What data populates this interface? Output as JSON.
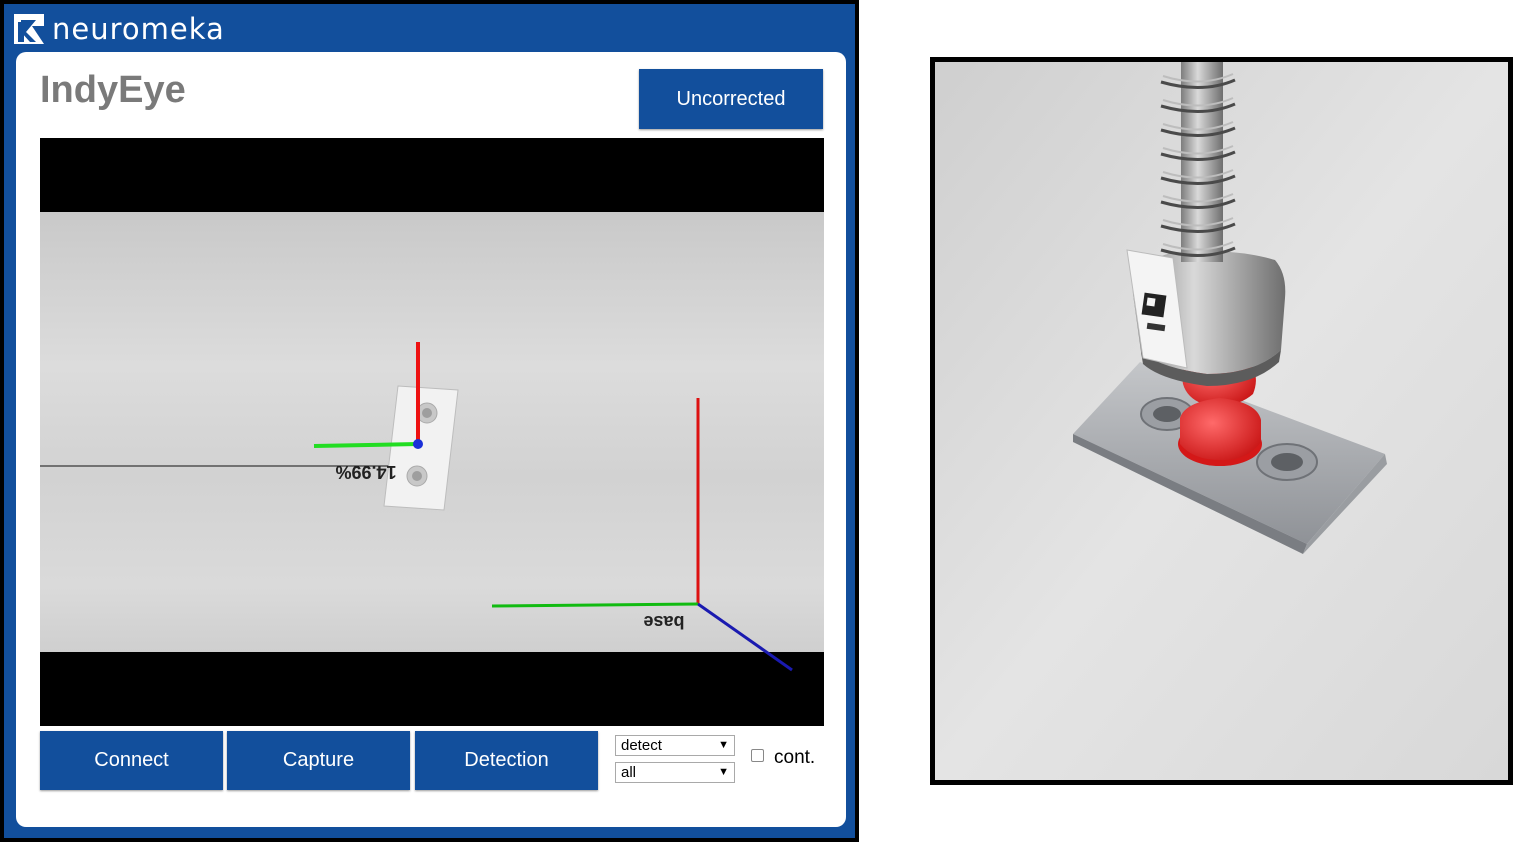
{
  "brand": {
    "name": "neuromeka",
    "logo": "neuromeka-logo-icon"
  },
  "app": {
    "title": "IndyEye",
    "mode_button": "Uncorrected"
  },
  "viewer": {
    "object_label": "14.99%",
    "base_label": "base",
    "axis_colors": {
      "x": "#ff0000",
      "y": "#00cc00",
      "z": "#0000cc"
    }
  },
  "controls": {
    "connect": "Connect",
    "capture": "Capture",
    "detection": "Detection",
    "mode_select": {
      "value": "detect"
    },
    "filter_select": {
      "value": "all"
    },
    "continuous": {
      "label": "cont.",
      "checked": false
    }
  },
  "colors": {
    "brand_blue": "#124f9c",
    "title_gray": "#7a7a7a"
  }
}
